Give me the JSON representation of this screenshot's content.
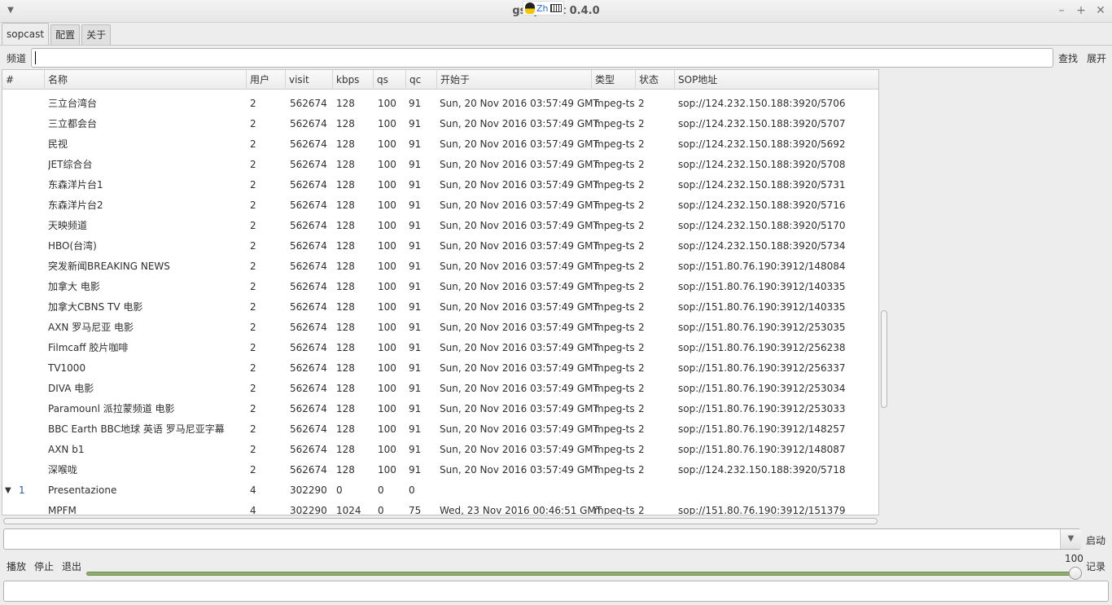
{
  "window": {
    "title": "gsopcast 0.4.0",
    "ime": {
      "label": "Zh"
    }
  },
  "tabs": [
    "sopcast",
    "配置",
    "关于"
  ],
  "search": {
    "label": "频道",
    "value": "",
    "find_label": "查找",
    "expand_label": "展开"
  },
  "table": {
    "columns": [
      "#",
      "名称",
      "用户",
      "visit",
      "kbps",
      "qs",
      "qc",
      "开始于",
      "类型",
      "状态",
      "SOP地址"
    ],
    "rows": [
      {
        "expander": "",
        "idx": "",
        "name": "三立台湾台",
        "users": "2",
        "visit": "562674",
        "kbps": "128",
        "qs": "100",
        "qc": "91",
        "start": "Sun, 20 Nov 2016 03:57:49 GMT",
        "type": "mpeg-ts",
        "status": "2",
        "sop": "sop://124.232.150.188:3920/5706"
      },
      {
        "expander": "",
        "idx": "",
        "name": "三立都会台",
        "users": "2",
        "visit": "562674",
        "kbps": "128",
        "qs": "100",
        "qc": "91",
        "start": "Sun, 20 Nov 2016 03:57:49 GMT",
        "type": "mpeg-ts",
        "status": "2",
        "sop": "sop://124.232.150.188:3920/5707"
      },
      {
        "expander": "",
        "idx": "",
        "name": "民视",
        "users": "2",
        "visit": "562674",
        "kbps": "128",
        "qs": "100",
        "qc": "91",
        "start": "Sun, 20 Nov 2016 03:57:49 GMT",
        "type": "mpeg-ts",
        "status": "2",
        "sop": "sop://124.232.150.188:3920/5692"
      },
      {
        "expander": "",
        "idx": "",
        "name": "JET综合台",
        "users": "2",
        "visit": "562674",
        "kbps": "128",
        "qs": "100",
        "qc": "91",
        "start": "Sun, 20 Nov 2016 03:57:49 GMT",
        "type": "mpeg-ts",
        "status": "2",
        "sop": "sop://124.232.150.188:3920/5708"
      },
      {
        "expander": "",
        "idx": "",
        "name": "东森洋片台1",
        "users": "2",
        "visit": "562674",
        "kbps": "128",
        "qs": "100",
        "qc": "91",
        "start": "Sun, 20 Nov 2016 03:57:49 GMT",
        "type": "mpeg-ts",
        "status": "2",
        "sop": "sop://124.232.150.188:3920/5731"
      },
      {
        "expander": "",
        "idx": "",
        "name": "东森洋片台2",
        "users": "2",
        "visit": "562674",
        "kbps": "128",
        "qs": "100",
        "qc": "91",
        "start": "Sun, 20 Nov 2016 03:57:49 GMT",
        "type": "mpeg-ts",
        "status": "2",
        "sop": "sop://124.232.150.188:3920/5716"
      },
      {
        "expander": "",
        "idx": "",
        "name": "天映频道",
        "users": "2",
        "visit": "562674",
        "kbps": "128",
        "qs": "100",
        "qc": "91",
        "start": "Sun, 20 Nov 2016 03:57:49 GMT",
        "type": "mpeg-ts",
        "status": "2",
        "sop": "sop://124.232.150.188:3920/5170"
      },
      {
        "expander": "",
        "idx": "",
        "name": "HBO(台湾)",
        "users": "2",
        "visit": "562674",
        "kbps": "128",
        "qs": "100",
        "qc": "91",
        "start": "Sun, 20 Nov 2016 03:57:49 GMT",
        "type": "mpeg-ts",
        "status": "2",
        "sop": "sop://124.232.150.188:3920/5734"
      },
      {
        "expander": "",
        "idx": "",
        "name": "突发新闻BREAKING NEWS",
        "users": "2",
        "visit": "562674",
        "kbps": "128",
        "qs": "100",
        "qc": "91",
        "start": "Sun, 20 Nov 2016 03:57:49 GMT",
        "type": "mpeg-ts",
        "status": "2",
        "sop": "sop://151.80.76.190:3912/148084"
      },
      {
        "expander": "",
        "idx": "",
        "name": "加拿大 电影",
        "users": "2",
        "visit": "562674",
        "kbps": "128",
        "qs": "100",
        "qc": "91",
        "start": "Sun, 20 Nov 2016 03:57:49 GMT",
        "type": "mpeg-ts",
        "status": "2",
        "sop": "sop://151.80.76.190:3912/140335"
      },
      {
        "expander": "",
        "idx": "",
        "name": "加拿大CBNS TV 电影",
        "users": "2",
        "visit": "562674",
        "kbps": "128",
        "qs": "100",
        "qc": "91",
        "start": "Sun, 20 Nov 2016 03:57:49 GMT",
        "type": "mpeg-ts",
        "status": "2",
        "sop": "sop://151.80.76.190:3912/140335"
      },
      {
        "expander": "",
        "idx": "",
        "name": "AXN 罗马尼亚 电影",
        "users": "2",
        "visit": "562674",
        "kbps": "128",
        "qs": "100",
        "qc": "91",
        "start": "Sun, 20 Nov 2016 03:57:49 GMT",
        "type": "mpeg-ts",
        "status": "2",
        "sop": "sop://151.80.76.190:3912/253035"
      },
      {
        "expander": "",
        "idx": "",
        "name": "Filmcaff 胶片咖啡",
        "users": "2",
        "visit": "562674",
        "kbps": "128",
        "qs": "100",
        "qc": "91",
        "start": "Sun, 20 Nov 2016 03:57:49 GMT",
        "type": "mpeg-ts",
        "status": "2",
        "sop": "sop://151.80.76.190:3912/256238"
      },
      {
        "expander": "",
        "idx": "",
        "name": "TV1000",
        "users": "2",
        "visit": "562674",
        "kbps": "128",
        "qs": "100",
        "qc": "91",
        "start": "Sun, 20 Nov 2016 03:57:49 GMT",
        "type": "mpeg-ts",
        "status": "2",
        "sop": "sop://151.80.76.190:3912/256337"
      },
      {
        "expander": "",
        "idx": "",
        "name": "DIVA 电影",
        "users": "2",
        "visit": "562674",
        "kbps": "128",
        "qs": "100",
        "qc": "91",
        "start": "Sun, 20 Nov 2016 03:57:49 GMT",
        "type": "mpeg-ts",
        "status": "2",
        "sop": "sop://151.80.76.190:3912/253034"
      },
      {
        "expander": "",
        "idx": "",
        "name": "Paramounl 派拉蒙频道 电影",
        "users": "2",
        "visit": "562674",
        "kbps": "128",
        "qs": "100",
        "qc": "91",
        "start": "Sun, 20 Nov 2016 03:57:49 GMT",
        "type": "mpeg-ts",
        "status": "2",
        "sop": "sop://151.80.76.190:3912/253033"
      },
      {
        "expander": "",
        "idx": "",
        "name": "BBC Earth BBC地球 英语 罗马尼亚字幕",
        "users": "2",
        "visit": "562674",
        "kbps": "128",
        "qs": "100",
        "qc": "91",
        "start": "Sun, 20 Nov 2016 03:57:49 GMT",
        "type": "mpeg-ts",
        "status": "2",
        "sop": "sop://151.80.76.190:3912/148257"
      },
      {
        "expander": "",
        "idx": "",
        "name": "AXN b1",
        "users": "2",
        "visit": "562674",
        "kbps": "128",
        "qs": "100",
        "qc": "91",
        "start": "Sun, 20 Nov 2016 03:57:49 GMT",
        "type": "mpeg-ts",
        "status": "2",
        "sop": "sop://151.80.76.190:3912/148087"
      },
      {
        "expander": "",
        "idx": "",
        "name": "深喉咙",
        "users": "2",
        "visit": "562674",
        "kbps": "128",
        "qs": "100",
        "qc": "91",
        "start": "Sun, 20 Nov 2016 03:57:49 GMT",
        "type": "mpeg-ts",
        "status": "2",
        "sop": "sop://124.232.150.188:3920/5718"
      },
      {
        "expander": "▼",
        "idx": "1",
        "name": "Presentazione",
        "users": "4",
        "visit": "302290",
        "kbps": "0",
        "qs": "0",
        "qc": "0",
        "start": "",
        "type": "",
        "status": "",
        "sop": ""
      },
      {
        "expander": "",
        "idx": "",
        "name": "MPFM",
        "users": "4",
        "visit": "302290",
        "kbps": "1024",
        "qs": "0",
        "qc": "75",
        "start": "Wed, 23 Nov 2016 00:46:51 GMT",
        "type": "mpeg-ts",
        "status": "2",
        "sop": "sop://151.80.76.190:3912/151379"
      }
    ]
  },
  "player": {
    "combo_value": "",
    "start_label": "启动",
    "play_label": "播放",
    "stop_label": "停止",
    "quit_label": "退出",
    "volume": 100,
    "volume_label": "100",
    "record_label": "记录",
    "status_text": ""
  }
}
